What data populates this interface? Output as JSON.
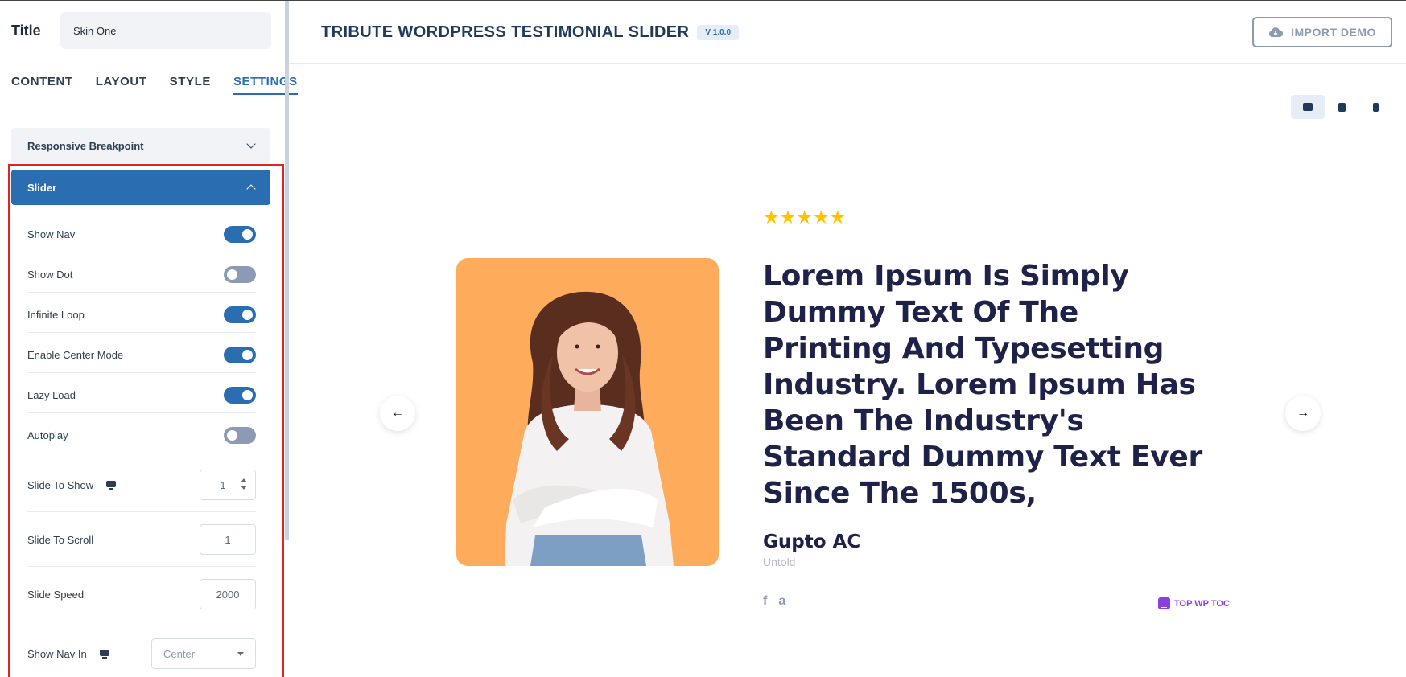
{
  "sidebar": {
    "title_label": "Title",
    "title_value": "Skin One",
    "tabs": [
      {
        "label": "CONTENT"
      },
      {
        "label": "LAYOUT"
      },
      {
        "label": "STYLE"
      },
      {
        "label": "SETTINGS",
        "active": true
      }
    ],
    "accordions": {
      "responsive": "Responsive Breakpoint",
      "slider": "Slider"
    },
    "settings": {
      "show_nav": {
        "label": "Show Nav",
        "on": true
      },
      "show_dot": {
        "label": "Show Dot",
        "on": false
      },
      "infinite_loop": {
        "label": "Infinite Loop",
        "on": true
      },
      "center_mode": {
        "label": "Enable Center Mode",
        "on": true
      },
      "lazy_load": {
        "label": "Lazy Load",
        "on": true
      },
      "autoplay": {
        "label": "Autoplay",
        "on": false
      },
      "slide_to_show": {
        "label": "Slide To Show",
        "value": "1"
      },
      "slide_to_scroll": {
        "label": "Slide To Scroll",
        "value": "1"
      },
      "slide_speed": {
        "label": "Slide Speed",
        "value": "2000"
      },
      "show_nav_in": {
        "label": "Show Nav In",
        "value": "Center"
      }
    }
  },
  "header": {
    "title": "TRIBUTE WORDPRESS TESTIMONIAL SLIDER",
    "version": "V 1.0.0",
    "import_label": "IMPORT DEMO",
    "devices": [
      "desktop-icon",
      "tablet-icon",
      "mobile-icon"
    ]
  },
  "testimonial": {
    "stars": "★★★★★",
    "rating": 5,
    "quote": "Lorem Ipsum Is Simply Dummy Text Of The Printing And Typesetting Industry. Lorem Ipsum Has Been The Industry's Standard Dummy Text Ever Since The 1500s,",
    "author": "Gupto AC",
    "company": "Untold",
    "socials": [
      "f",
      "a"
    ],
    "badge": "TOP WP TOC",
    "prev": "←",
    "next": "→"
  },
  "colors": {
    "accent": "#2a6db1",
    "highlight_frame": "#e02424",
    "photo_bg": "#ffab5c",
    "star": "#ffc200",
    "toc": "#8b3fe0"
  }
}
